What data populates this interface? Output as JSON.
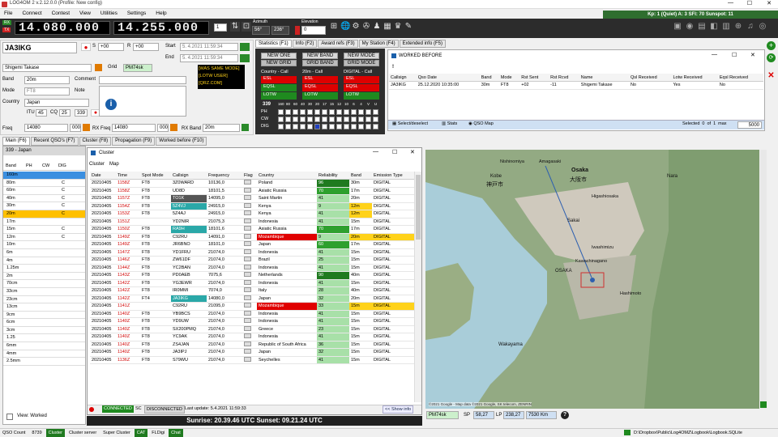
{
  "app": {
    "title": "LOG4OM 2 v.2.12.0.0 (Profile: New config)",
    "status_strip": "Kp: 1 (Quiet)  A: 3  SFI: 70 Sunspot: 11"
  },
  "menu": [
    "File",
    "Connect",
    "Contest",
    "View",
    "Utilities",
    "Settings",
    "Help"
  ],
  "toolbar": {
    "rx_label": "RX",
    "tx_label": "TX",
    "rx_freq": "14.080.000",
    "tx_freq": "14.255.000",
    "vfo": "1",
    "azimuth_label": "Azimuth",
    "azimuth_a": "56°",
    "azimuth_b": "236°",
    "elevation_label": "Elevation",
    "elevation": "0"
  },
  "qso": {
    "callsign": "JA3IKG",
    "s_label": "S",
    "s_value": "+00",
    "r_label": "R",
    "r_value": "+00",
    "start_label": "Start",
    "start": "5. 4.2021 11:59:34",
    "end_label": "End",
    "end": "5. 4.2021 11:59:34",
    "name": "Shigemi Takase",
    "grid_label": "Grid",
    "grid": "PM74sk",
    "band_label": "Band",
    "band": "20m",
    "mode_label": "Mode",
    "mode": "FT8",
    "country_label": "Country",
    "country": "Japan",
    "itu_label": "ITU",
    "itu": "45",
    "cq_label": "CQ",
    "cq": "25",
    "dxcc": "339",
    "comment_label": "Comment",
    "note_label": "Note",
    "freq_label": "Freq",
    "freq": "14080",
    "freq_khz": "000",
    "rxfreq_label": "RX Freq",
    "rxfreq": "14080",
    "rxfreq_khz": "000",
    "rxband_label": "RX Band",
    "rxband": "20m",
    "badges": [
      "[WAS SAME MODE]",
      "[LOTW USER]",
      "[QRZ.COM]"
    ]
  },
  "info_tabs": [
    "Statistics (F1)",
    "Info (F2)",
    "Award refs (F3)",
    "My Station (F4)",
    "Extended info (F5)"
  ],
  "stats": {
    "buttons": [
      "NEW ONE",
      "NEW BAND",
      "NEW MODE",
      "NEW GRID",
      "GRID BAND",
      "GRID MODE"
    ],
    "groups": [
      "Country - Call",
      "20m - Call",
      "DIGITAL - Call"
    ],
    "rows": [
      "ESL",
      "EQSL",
      "LOTW"
    ],
    "dxcc": "339",
    "bands": [
      "160",
      "80",
      "60",
      "40",
      "30",
      "20",
      "17",
      "15",
      "12",
      "10",
      "6",
      "4",
      "V",
      "U"
    ],
    "modes": [
      "PH",
      "CW",
      "DIG"
    ]
  },
  "worked_before": {
    "title": "WORKED BEFORE",
    "filter": "!",
    "columns": [
      "Callsign",
      "Qso Date",
      "Band",
      "Mode",
      "Rst Sent",
      "Rst Rcvd",
      "Name",
      "Qsl Received",
      "Lotw Received",
      "Eqsl Received"
    ],
    "rows": [
      [
        "JA3IKG",
        "25.12.2020 10:35:00",
        "30m",
        "FT8",
        "+02",
        "-11",
        "Shigemi Takase",
        "No",
        "Yes",
        "No"
      ]
    ],
    "footer_select": "Select/deselect",
    "footer_stats": "Stats",
    "footer_map": "QSO Map",
    "selected_label": "Selected",
    "selected": "0",
    "of_label": "of",
    "total": "1",
    "max_label": "max",
    "max": "5000"
  },
  "bottom_tabs": [
    "Main (F6)",
    "Recent QSO's (F7)",
    "Cluster (F8)",
    "Propagation (F9)",
    "Worked before (F10)"
  ],
  "band_panel": {
    "header": "339 - Japan",
    "columns": [
      "Band",
      "PH",
      "CW",
      "DIG"
    ],
    "bands": [
      "160m",
      "80m",
      "60m",
      "40m",
      "30m",
      "20m",
      "17m",
      "15m",
      "12m",
      "10m",
      "6m",
      "4m",
      "1.25m",
      "2m",
      "70cm",
      "33cm",
      "23cm",
      "13cm",
      "9cm",
      "6cm",
      "3cm",
      "1.25",
      "6mm",
      "4mm",
      "2.5mm"
    ],
    "c_rows": [
      1,
      2,
      3,
      4,
      5,
      7,
      8
    ],
    "view_label": "View: Worked"
  },
  "cluster": {
    "title": "Cluster",
    "tabs": [
      "Cluster",
      "Map"
    ],
    "columns": [
      "Date",
      "Time",
      "Spot Mode",
      "Callsign",
      "Frequency",
      "Flag",
      "Country",
      "Reliability",
      "Band",
      "Emission Type"
    ],
    "rows": [
      [
        "20210405",
        "1158Z",
        "FT8",
        "3Z0WARD",
        "10136,0",
        "Poland",
        "96",
        "30m",
        "DIGITAL"
      ],
      [
        "20210405",
        "1158Z",
        "FT8",
        "UD8D",
        "18101,5",
        "Asiatic Russia",
        "70",
        "17m",
        "DIGITAL"
      ],
      [
        "20210405",
        "1157Z",
        "FT8",
        "TO1K",
        "14095,0",
        "Saint Martin",
        "41",
        "20m",
        "DIGITAL"
      ],
      [
        "20210405",
        "1154Z",
        "FT8",
        "5Z4VJ",
        "24915,0",
        "Kenya",
        "9",
        "12m",
        "DIGITAL"
      ],
      [
        "20210405",
        "1153Z",
        "FT8",
        "5Z4AJ",
        "24915,0",
        "Kenya",
        "41",
        "12m",
        "DIGITAL"
      ],
      [
        "20210405",
        "1151Z",
        "",
        "YD2NIR",
        "21075,3",
        "Indonesia",
        "41",
        "15m",
        "DIGITAL"
      ],
      [
        "20210405",
        "1150Z",
        "FT8",
        "RA9H",
        "18101,6",
        "Asiatic Russia",
        "70",
        "17m",
        "DIGITAL"
      ],
      [
        "20210405",
        "1149Z",
        "FT8",
        "C92RU",
        "14091,0",
        "Mozambique",
        "9",
        "20m",
        "DIGITAL"
      ],
      [
        "20210405",
        "1149Z",
        "FT8",
        "JR6BNO",
        "18101,0",
        "Japan",
        "60",
        "17m",
        "DIGITAL"
      ],
      [
        "20210405",
        "1147Z",
        "FT8",
        "YD1FRU",
        "21074,0",
        "Indonesia",
        "41",
        "15m",
        "DIGITAL"
      ],
      [
        "20210405",
        "1146Z",
        "FT8",
        "ZW61DF",
        "21074,0",
        "Brazil",
        "25",
        "15m",
        "DIGITAL"
      ],
      [
        "20210405",
        "1144Z",
        "FT8",
        "YC2BAN",
        "21074,0",
        "Indonesia",
        "41",
        "15m",
        "DIGITAL"
      ],
      [
        "20210405",
        "1143Z",
        "FT8",
        "PD0AEB",
        "7075,6",
        "Netherlands",
        "90",
        "40m",
        "DIGITAL"
      ],
      [
        "20210405",
        "1142Z",
        "FT8",
        "YG3EWR",
        "21074,0",
        "Indonesia",
        "41",
        "15m",
        "DIGITAL"
      ],
      [
        "20210405",
        "1142Z",
        "FT8",
        "IR0MMI",
        "7074,0",
        "Italy",
        "28",
        "40m",
        "DIGITAL"
      ],
      [
        "20210405",
        "1142Z",
        "FT4",
        "JA3IKG",
        "14080,0",
        "Japan",
        "32",
        "20m",
        "DIGITAL"
      ],
      [
        "20210405",
        "1141Z",
        "",
        "C92RU",
        "21095,0",
        "Mozambique",
        "33",
        "15m",
        "DIGITAL"
      ],
      [
        "20210405",
        "1140Z",
        "FT8",
        "YB9BCS",
        "21074,0",
        "Indonesia",
        "41",
        "15m",
        "DIGITAL"
      ],
      [
        "20210405",
        "1140Z",
        "FT8",
        "YD9UW",
        "21074,0",
        "Indonesia",
        "41",
        "15m",
        "DIGITAL"
      ],
      [
        "20210405",
        "1140Z",
        "FT8",
        "SX200PMQ",
        "21074,0",
        "Greece",
        "23",
        "15m",
        "DIGITAL"
      ],
      [
        "20210405",
        "1140Z",
        "FT8",
        "YC9AK",
        "21074,0",
        "Indonesia",
        "41",
        "15m",
        "DIGITAL"
      ],
      [
        "20210405",
        "1140Z",
        "FT8",
        "ZS4JAN",
        "21074,0",
        "Republic of South Africa",
        "36",
        "15m",
        "DIGITAL"
      ],
      [
        "20210405",
        "1140Z",
        "FT8",
        "JA3IPJ",
        "21074,0",
        "Japan",
        "32",
        "15m",
        "DIGITAL"
      ],
      [
        "20210405",
        "1136Z",
        "FT8",
        "S79WU",
        "21074,0",
        "Seychelles",
        "41",
        "15m",
        "DIGITAL"
      ]
    ],
    "status_connected": "CONNECTED",
    "status_sc": "SC",
    "status_disconnected": "DISCONNECTED",
    "last_update": "Last update: 5.4.2021 11:59:33",
    "show_info": "<< Show info"
  },
  "sun": "Sunrise: 20.39.46 UTC  Sunset: 09.21.24 UTC",
  "map": {
    "grid": "PM74sk",
    "sp_label": "SP",
    "sp": "58,27",
    "lp_label": "LP",
    "lp": "238,27",
    "distance": "7530 Km",
    "copyright": "©2021 Google - Map data ©2021 Google, SK telecom, ZENRIN",
    "labels": [
      "Kobe",
      "神戸市",
      "Osaka",
      "大阪市",
      "Sakai",
      "OSAKA",
      "Wakayama",
      "Nishinomiya",
      "Amagasaki",
      "Higashiosaka",
      "Kawachinagano",
      "Iwashimizu",
      "Hashimoto",
      "Nara"
    ]
  },
  "bottom_status": {
    "qso_count_label": "QSO Count",
    "qso_count": "8739",
    "cluster": "Cluster",
    "cluster_server": "Cluster server",
    "super_cluster": "Super Cluster",
    "cat": "CAT",
    "fldigi": "FLDigi",
    "chat": "Chat",
    "path": "D:\\Dropbox\\Public\\Log4OMZ\\Logbook\\Logbook.SQLite"
  }
}
